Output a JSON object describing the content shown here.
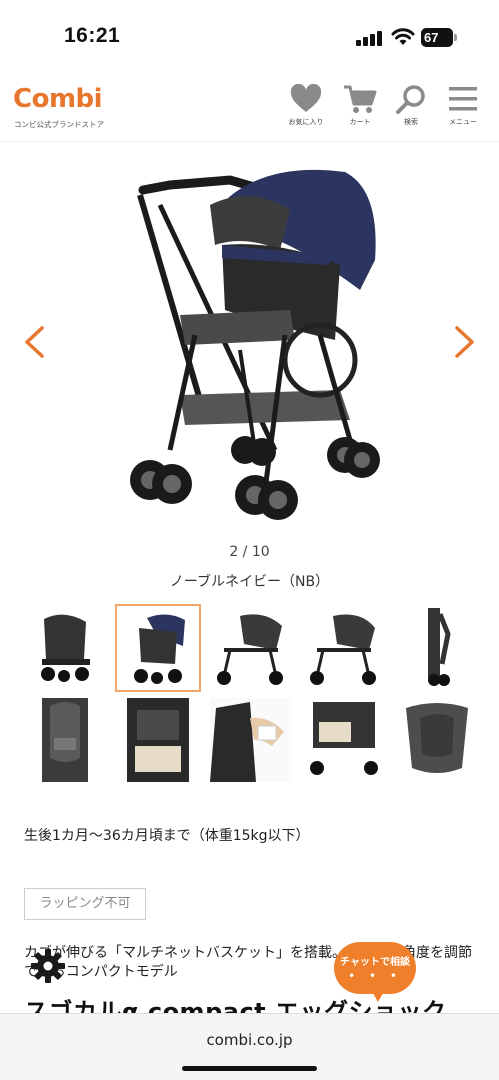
{
  "status_bar": {
    "time": "16:21",
    "battery": "67"
  },
  "header": {
    "logo": "Combi",
    "logo_sub": "コンビ公式ブランドストア",
    "favorites_label": "お気に入り",
    "cart_label": "カート",
    "search_label": "検索",
    "menu_label": "メニュー"
  },
  "gallery": {
    "counter": "2 / 10",
    "color_name": "ノーブルネイビー（NB）",
    "thumbnails": [
      {
        "label": "stroller-front-black"
      },
      {
        "label": "stroller-front-navy",
        "active": true
      },
      {
        "label": "stroller-side"
      },
      {
        "label": "stroller-side-2"
      },
      {
        "label": "stroller-folded"
      },
      {
        "label": "seat-cushion"
      },
      {
        "label": "seat-closeup"
      },
      {
        "label": "basket-hand"
      },
      {
        "label": "stroller-rear"
      },
      {
        "label": "seat-liner"
      }
    ]
  },
  "product": {
    "age_range": "生後1カ月〜36カ月頃まで（体重15kg以下）",
    "badge": "ラッピング不可",
    "description": "カゴが伸びる「マルチネットバスケット」を搭載。ハンドル角度を調節できるコンパクトモデル",
    "title": "スゴカルα compact エッグショック"
  },
  "chat": {
    "label": "チャットで相談",
    "dots": "• • •"
  },
  "browser": {
    "url": "combi.co.jp"
  },
  "colors": {
    "brand_orange": "#e8772e",
    "navy": "#2b3560"
  }
}
